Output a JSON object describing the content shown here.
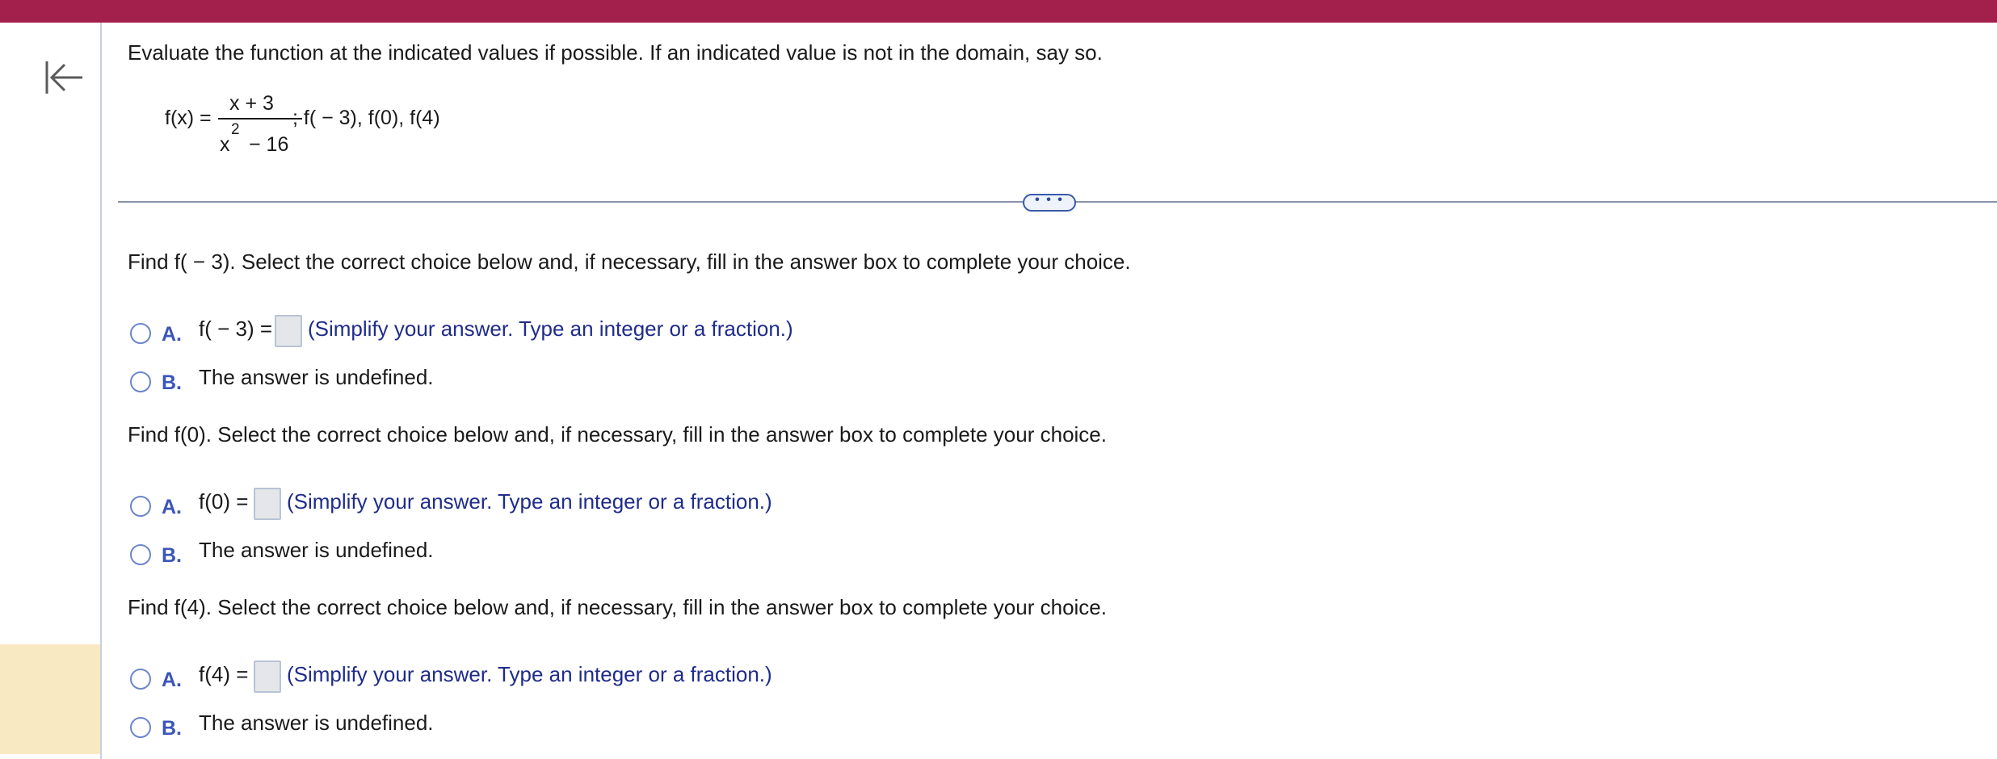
{
  "header": {
    "bar_color": "#a3204c"
  },
  "sidebar": {
    "collapse_icon": "collapse-left-icon",
    "highlight_color": "#f9e9c2"
  },
  "problem": {
    "instruction": "Evaluate the function at the indicated values if possible. If an indicated value is not in the domain, say so.",
    "function_lhs": "f(x) =",
    "numerator": "x + 3",
    "denominator_base": "x",
    "denominator_exp": "2",
    "denominator_rest": "− 16",
    "values_list": "; f( − 3), f(0), f(4)"
  },
  "expand_button": {
    "label": "• • •"
  },
  "parts": [
    {
      "prompt": "Find f( − 3). Select the correct choice below and, if necessary, fill in the answer box to complete your choice.",
      "choice_a_letter": "A.",
      "choice_a_prefix": "f( − 3) =",
      "choice_a_hint": "(Simplify your answer. Type an integer or a fraction.)",
      "choice_b_letter": "B.",
      "choice_b_text": "The answer is undefined."
    },
    {
      "prompt": "Find f(0). Select the correct choice below and, if necessary, fill in the answer box to complete your choice.",
      "choice_a_letter": "A.",
      "choice_a_prefix": "f(0) =",
      "choice_a_hint": "(Simplify your answer. Type an integer or a fraction.)",
      "choice_b_letter": "B.",
      "choice_b_text": "The answer is undefined."
    },
    {
      "prompt": "Find f(4). Select the correct choice below and, if necessary, fill in the answer box to complete your choice.",
      "choice_a_letter": "A.",
      "choice_a_prefix": "f(4) =",
      "choice_a_hint": "(Simplify your answer. Type an integer or a fraction.)",
      "choice_b_letter": "B.",
      "choice_b_text": "The answer is undefined."
    }
  ]
}
